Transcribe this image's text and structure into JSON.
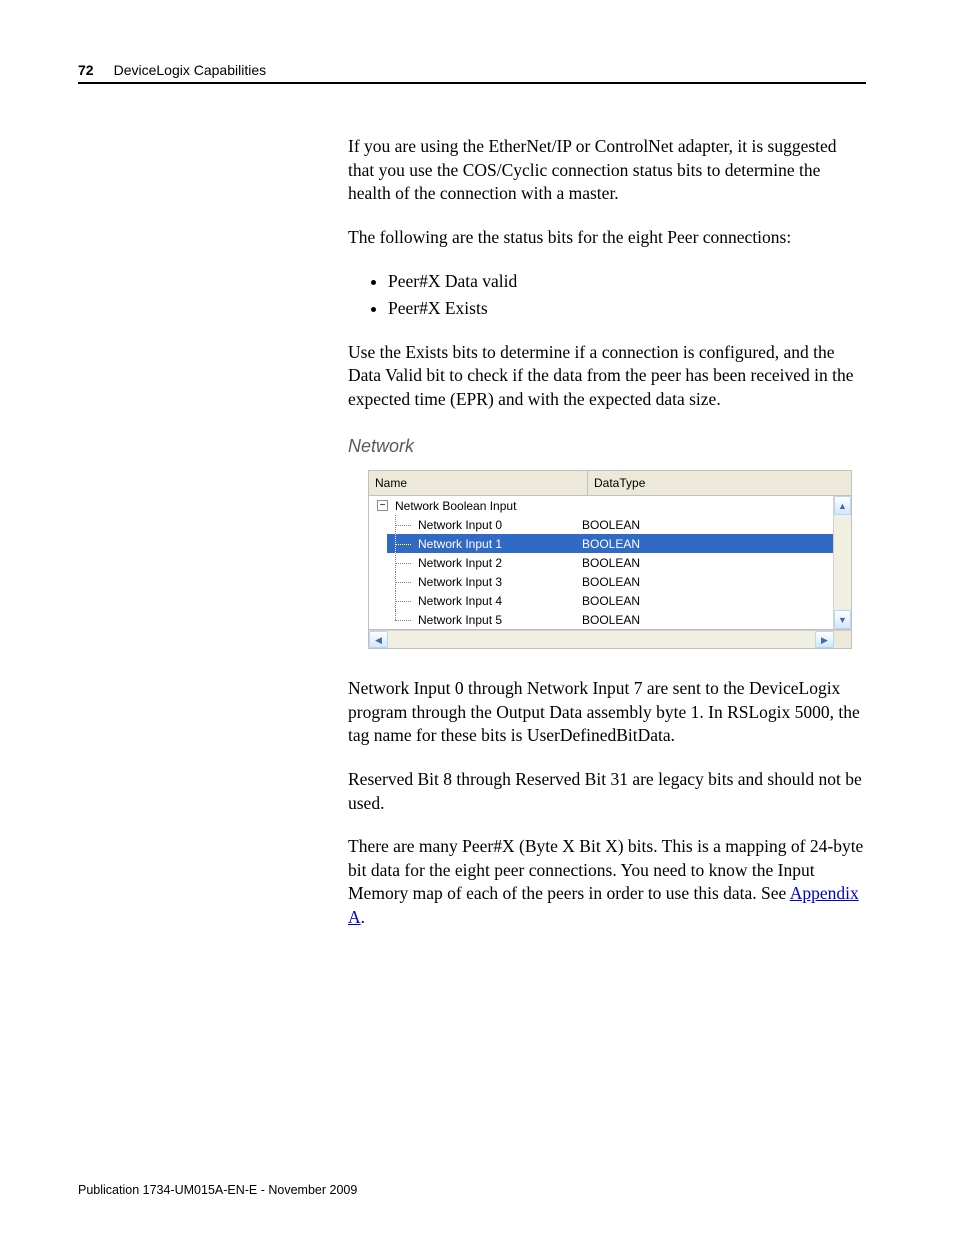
{
  "header": {
    "page_number": "72",
    "title": "DeviceLogix Capabilities"
  },
  "body": {
    "p1": "If you are using the EtherNet/IP or ControlNet adapter, it is suggested that you use the COS/Cyclic connection status bits to determine the health of the connection with a master.",
    "p2": "The following are the status bits for the eight Peer connections:",
    "bullets": [
      "Peer#X Data valid",
      "Peer#X Exists"
    ],
    "p3": "Use the Exists bits to determine if a connection is configured, and the Data Valid bit to check if the data from the peer has been received in the expected time (EPR) and with the expected data size.",
    "section_heading": "Network",
    "p4": "Network Input 0 through Network Input 7 are sent to the DeviceLogix program through the Output Data assembly byte 1. In RSLogix 5000, the tag name for these bits is UserDefinedBitData.",
    "p5": "Reserved Bit 8 through Reserved Bit 31 are legacy bits and should not be used.",
    "p6_a": "There are many Peer#X (Byte X Bit X) bits. This is a mapping of 24-byte bit data for the eight peer connections. You need to know the Input Memory map of each of the peers in order to use this data. See ",
    "p6_link": "Appendix A",
    "p6_b": "."
  },
  "tree": {
    "columns": {
      "name": "Name",
      "datatype": "DataType"
    },
    "toggle": "−",
    "parent": "Network Boolean Input",
    "rows": [
      {
        "label": "Network Input 0",
        "dtype": "BOOLEAN",
        "selected": false
      },
      {
        "label": "Network Input 1",
        "dtype": "BOOLEAN",
        "selected": true
      },
      {
        "label": "Network Input 2",
        "dtype": "BOOLEAN",
        "selected": false
      },
      {
        "label": "Network Input 3",
        "dtype": "BOOLEAN",
        "selected": false
      },
      {
        "label": "Network Input 4",
        "dtype": "BOOLEAN",
        "selected": false
      },
      {
        "label": "Network Input 5",
        "dtype": "BOOLEAN",
        "selected": false
      }
    ],
    "scroll": {
      "up": "▲",
      "down": "▼",
      "left": "◀",
      "right": "▶"
    }
  },
  "footer": "Publication 1734-UM015A-EN-E - November 2009"
}
